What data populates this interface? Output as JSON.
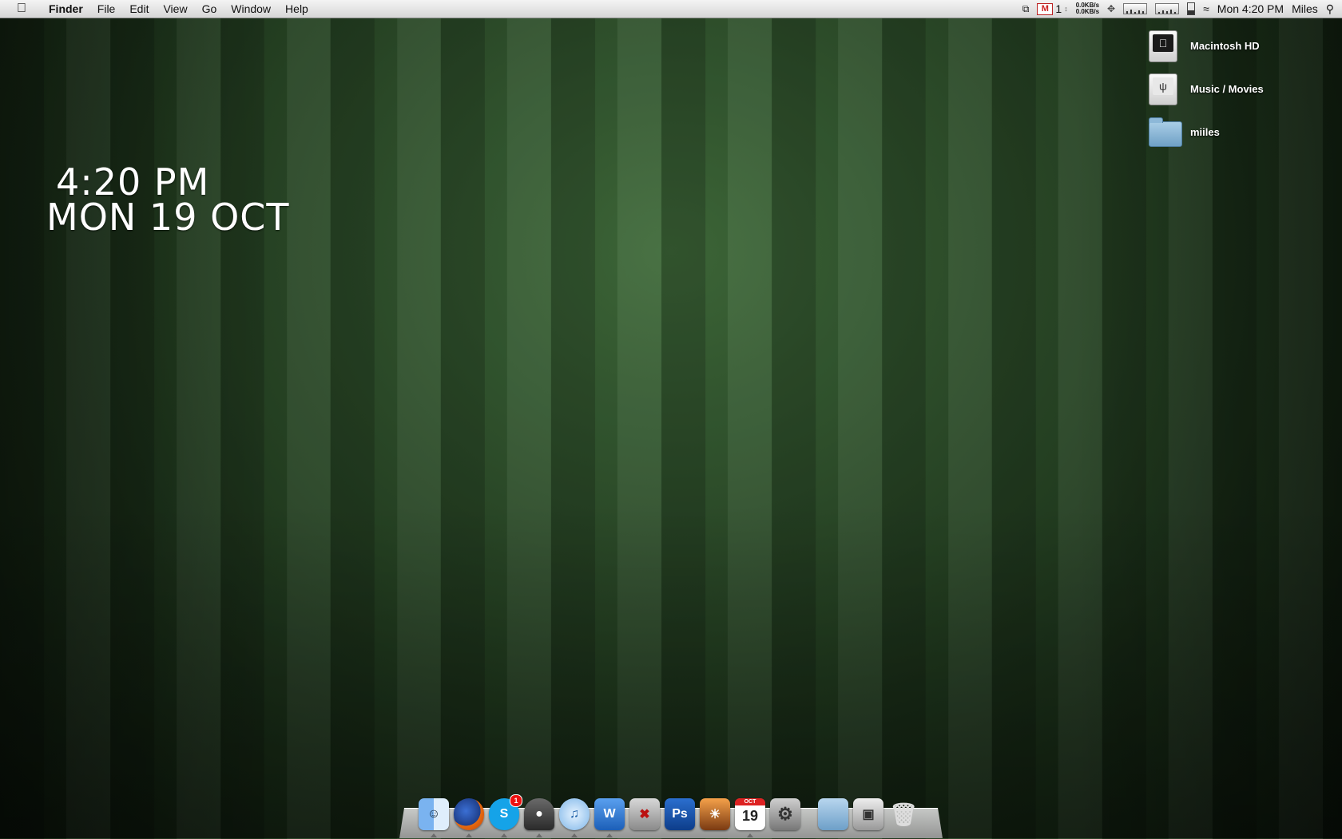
{
  "menubar": {
    "app_name": "Finder",
    "menus": [
      "File",
      "Edit",
      "View",
      "Go",
      "Window",
      "Help"
    ],
    "gmail_count": "1",
    "net_up": "0.0KB/s",
    "net_down": "0.0KB/s",
    "clock": "Mon 4:20 PM",
    "user": "Miles"
  },
  "widget": {
    "time": "4:20 PM",
    "date": "MON 19 OCT"
  },
  "desktop": {
    "icons": [
      {
        "label": "Macintosh HD",
        "icon": "hard-drive-icon"
      },
      {
        "label": "Music / Movies",
        "icon": "usb-drive-icon"
      },
      {
        "label": "miiles",
        "icon": "folder-icon"
      }
    ]
  },
  "dock": {
    "apps": [
      "finder-icon",
      "firefox-icon",
      "skype-icon",
      "adium-icon",
      "itunes-icon",
      "word-icon",
      "installer-icon",
      "photoshop-icon",
      "iphoto-icon",
      "ical-icon",
      "system-preferences-icon"
    ],
    "skype_badge": "1",
    "ical_day": "19",
    "ical_month": "OCT",
    "ps_label": "Ps",
    "word_label": "W",
    "skype_label": "S"
  }
}
